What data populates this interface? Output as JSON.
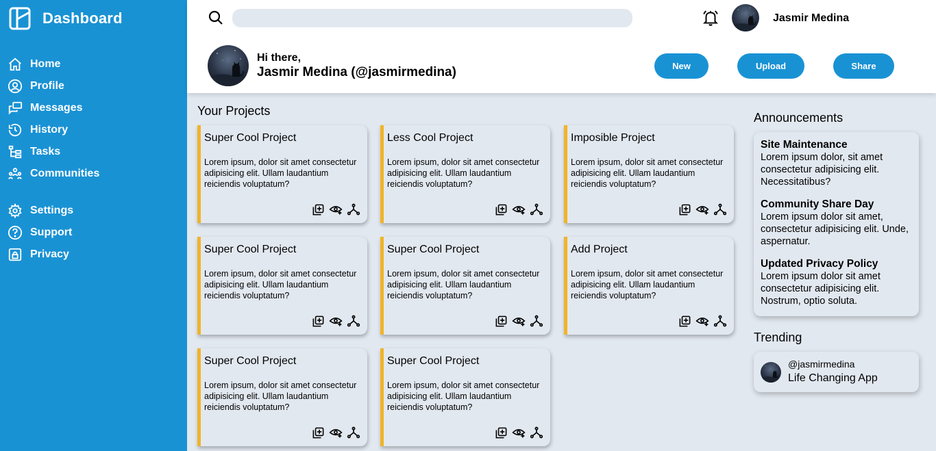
{
  "colors": {
    "sidebar": "#1992d4",
    "accent": "#1992d4",
    "card_border": "#f0b429",
    "background": "#e2e8f0"
  },
  "sidebar": {
    "title": "Dashboard",
    "items": [
      {
        "label": "Home",
        "icon": "home-icon"
      },
      {
        "label": "Profile",
        "icon": "user-circle-icon"
      },
      {
        "label": "Messages",
        "icon": "chat-icon"
      },
      {
        "label": "History",
        "icon": "history-icon"
      },
      {
        "label": "Tasks",
        "icon": "tasks-icon"
      },
      {
        "label": "Communities",
        "icon": "people-icon"
      }
    ],
    "secondary_items": [
      {
        "label": "Settings",
        "icon": "gear-icon"
      },
      {
        "label": "Support",
        "icon": "help-icon"
      },
      {
        "label": "Privacy",
        "icon": "lock-icon"
      }
    ]
  },
  "header": {
    "search_placeholder": "",
    "user_name": "Jasmir Medina",
    "greeting": "Hi there,",
    "full_name": "Jasmir Medina (@jasmirmedina)",
    "buttons": {
      "new": "New",
      "upload": "Upload",
      "share": "Share"
    }
  },
  "projects": {
    "title": "Your Projects",
    "cards": [
      {
        "title": "Super Cool Project",
        "body": "Lorem ipsum, dolor sit amet consectetur adipisicing elit. Ullam laudantium reiciendis voluptatum?"
      },
      {
        "title": "Less Cool Project",
        "body": "Lorem ipsum, dolor sit amet consectetur adipisicing elit. Ullam laudantium reiciendis voluptatum?"
      },
      {
        "title": "Imposible Project",
        "body": "Lorem ipsum, dolor sit amet consectetur adipisicing elit. Ullam laudantium reiciendis voluptatum?"
      },
      {
        "title": "Super Cool Project",
        "body": "Lorem ipsum, dolor sit amet consectetur adipisicing elit. Ullam laudantium reiciendis voluptatum?"
      },
      {
        "title": "Super Cool Project",
        "body": "Lorem ipsum, dolor sit amet consectetur adipisicing elit. Ullam laudantium reiciendis voluptatum?"
      },
      {
        "title": "Add Project",
        "body": "Lorem ipsum, dolor sit amet consectetur adipisicing elit. Ullam laudantium reiciendis voluptatum?"
      },
      {
        "title": "Super Cool Project",
        "body": "Lorem ipsum, dolor sit amet consectetur adipisicing elit. Ullam laudantium reiciendis voluptatum?"
      },
      {
        "title": "Super Cool Project",
        "body": "Lorem ipsum, dolor sit amet consectetur adipisicing elit. Ullam laudantium reiciendis voluptatum?"
      }
    ]
  },
  "announcements": {
    "title": "Announcements",
    "items": [
      {
        "title": "Site Maintenance",
        "body": "Lorem ipsum dolor, sit amet consectetur adipisicing elit. Necessitatibus?"
      },
      {
        "title": "Community Share Day",
        "body": "Lorem ipsum dolor sit amet, consectetur adipisicing elit. Unde, aspernatur."
      },
      {
        "title": "Updated Privacy Policy",
        "body": "Lorem ipsum dolor sit amet consectetur adipisicing elit. Nostrum, optio soluta."
      }
    ]
  },
  "trending": {
    "title": "Trending",
    "handle": "@jasmirmedina",
    "app": "Life Changing App"
  }
}
